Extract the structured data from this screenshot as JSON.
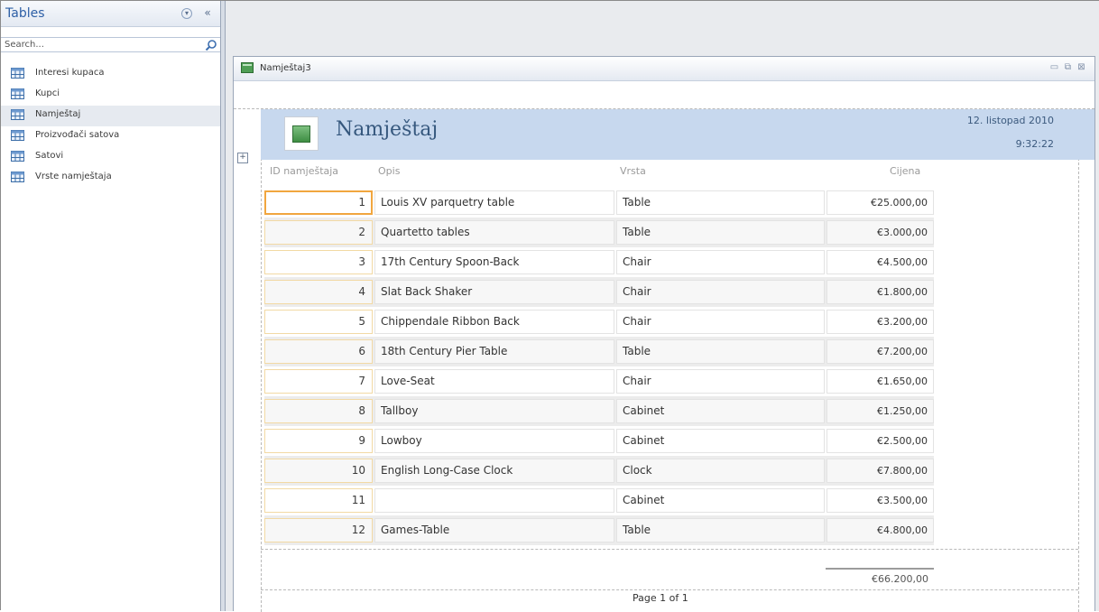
{
  "nav": {
    "title": "Tables",
    "menu_icon": "chevron-circle-down-icon",
    "collapse_icon": "double-chevron-left-icon",
    "search_placeholder": "Search...",
    "items": [
      {
        "label": "Interesi kupaca"
      },
      {
        "label": "Kupci"
      },
      {
        "label": "Namještaj"
      },
      {
        "label": "Proizvođači satova"
      },
      {
        "label": "Satovi"
      },
      {
        "label": "Vrste namještaja"
      }
    ]
  },
  "window": {
    "title": "Namještaj3",
    "controls": {
      "minimize": "▭",
      "restore": "⧉",
      "close": "⊠"
    }
  },
  "report": {
    "title": "Namještaj",
    "date": "12. listopad 2010",
    "time": "9:32:22",
    "columns": {
      "id": "ID namještaja",
      "opis": "Opis",
      "vrsta": "Vrsta",
      "cijena": "Cijena"
    },
    "rows": [
      {
        "id": "1",
        "opis": "Louis XV parquetry table",
        "vrsta": "Table",
        "cijena": "€25.000,00"
      },
      {
        "id": "2",
        "opis": "Quartetto tables",
        "vrsta": "Table",
        "cijena": "€3.000,00"
      },
      {
        "id": "3",
        "opis": "17th Century Spoon-Back",
        "vrsta": "Chair",
        "cijena": "€4.500,00"
      },
      {
        "id": "4",
        "opis": "Slat Back Shaker",
        "vrsta": "Chair",
        "cijena": "€1.800,00"
      },
      {
        "id": "5",
        "opis": "Chippendale Ribbon Back",
        "vrsta": "Chair",
        "cijena": "€3.200,00"
      },
      {
        "id": "6",
        "opis": "18th Century Pier Table",
        "vrsta": "Table",
        "cijena": "€7.200,00"
      },
      {
        "id": "7",
        "opis": "Love-Seat",
        "vrsta": "Chair",
        "cijena": "€1.650,00"
      },
      {
        "id": "8",
        "opis": "Tallboy",
        "vrsta": "Cabinet",
        "cijena": "€1.250,00"
      },
      {
        "id": "9",
        "opis": "Lowboy",
        "vrsta": "Cabinet",
        "cijena": "€2.500,00"
      },
      {
        "id": "10",
        "opis": "English Long-Case Clock",
        "vrsta": "Clock",
        "cijena": "€7.800,00"
      },
      {
        "id": "11",
        "opis": "",
        "vrsta": "Cabinet",
        "cijena": "€3.500,00"
      },
      {
        "id": "12",
        "opis": "Games-Table",
        "vrsta": "Table",
        "cijena": "€4.800,00"
      }
    ],
    "total": "€66.200,00",
    "footer": "Page 1 of 1"
  },
  "colors": {
    "header_band": "#c7d8ee",
    "title_text": "#36587e",
    "focus_border": "#f1a63f",
    "nav_title": "#2d5fa6"
  }
}
